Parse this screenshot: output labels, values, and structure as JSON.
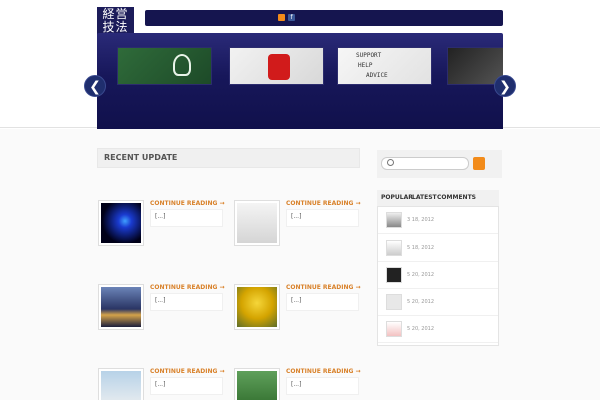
{
  "header": {
    "logo_text": "経営技法",
    "icons": [
      "rss-icon",
      "facebook-icon"
    ]
  },
  "slider": {
    "prev_label": "❮",
    "next_label": "❯",
    "slides": [
      "slide-1",
      "slide-2",
      "slide-3",
      "slide-4"
    ]
  },
  "main": {
    "section_title": "RECENT UPDATE",
    "posts": [
      {
        "more": "CONTINUE READING →",
        "excerpt": "[...]"
      },
      {
        "more": "CONTINUE READING →",
        "excerpt": "[...]"
      },
      {
        "more": "CONTINUE READING →",
        "excerpt": "[...]"
      },
      {
        "more": "CONTINUE READING →",
        "excerpt": "[...]"
      },
      {
        "more": "CONTINUE READING →",
        "excerpt": "[...]"
      },
      {
        "more": "CONTINUE READING →",
        "excerpt": "[...]"
      }
    ]
  },
  "sidebar": {
    "search": {
      "placeholder": ""
    },
    "tabs": [
      "POPULAR",
      "LATEST",
      "COMMENTS"
    ],
    "items": [
      {
        "date": "3 18, 2012"
      },
      {
        "date": "5 18, 2012"
      },
      {
        "date": "5 20, 2012"
      },
      {
        "date": "5 20, 2012"
      },
      {
        "date": "5 20, 2012"
      }
    ]
  },
  "colors": {
    "accent": "#f28b1a",
    "header_bar": "#15154f",
    "link": "#d9822b"
  }
}
